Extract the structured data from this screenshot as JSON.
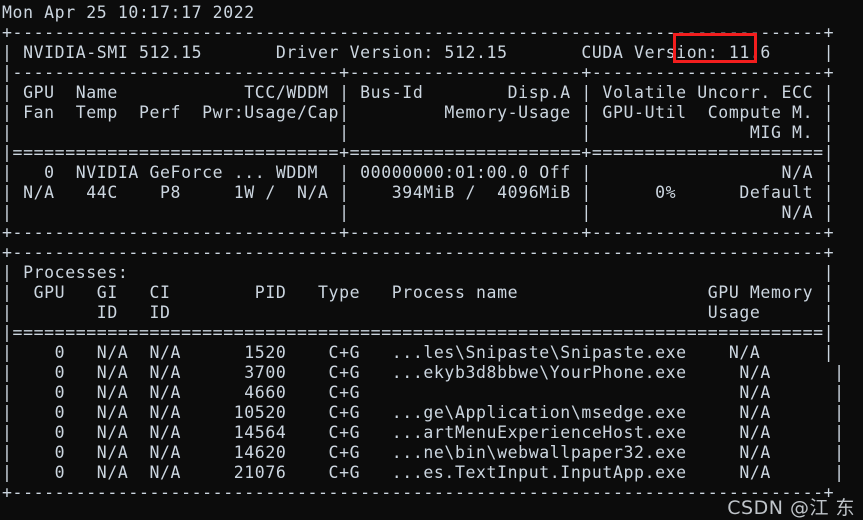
{
  "terminal": {
    "datestamp": "Mon Apr 25 10:17:17 2022",
    "background_color": "#0c0c0c",
    "text_color": "#ccd6e0",
    "highlight_color": "#f31e1e"
  },
  "smi_header": {
    "nvidia_smi_label": "NVIDIA-SMI",
    "nvidia_smi_version": "512.15",
    "driver_version_label": "Driver Version:",
    "driver_version": "512.15",
    "cuda_version_label": "CUDA Version:",
    "cuda_version": "11.6"
  },
  "gpu_table": {
    "header_row_1": [
      "GPU",
      "Name",
      "TCC/WDDM",
      "Bus-Id",
      "Disp.A",
      "Volatile Uncorr. ECC"
    ],
    "header_row_2": [
      "Fan",
      "Temp",
      "Perf",
      "Pwr:Usage/Cap",
      "Memory-Usage",
      "GPU-Util",
      "Compute M."
    ],
    "header_row_3": [
      "MIG M."
    ],
    "rows": [
      {
        "gpu": "0",
        "name": "NVIDIA GeForce ...",
        "tcc_wddm": "WDDM",
        "bus_id": "00000000:01:00.0",
        "disp_a": "Off",
        "ecc": "N/A",
        "fan": "N/A",
        "temp": "44C",
        "perf": "P8",
        "pwr_usage_cap": "1W /  N/A",
        "memory_usage": "394MiB /  4096MiB",
        "gpu_util": "0%",
        "compute_m": "Default",
        "mig_m": "N/A"
      }
    ]
  },
  "processes_section": {
    "title": "Processes:",
    "header_row_1": [
      "GPU",
      "GI",
      "CI",
      "PID",
      "Type",
      "Process name",
      "GPU Memory"
    ],
    "header_row_2": [
      "ID",
      "ID",
      "Usage"
    ],
    "rows": [
      {
        "gpu": "0",
        "gi_id": "N/A",
        "ci_id": "N/A",
        "pid": "1520",
        "type": "C+G",
        "process_name": "...les\\Snipaste\\Snipaste.exe",
        "gpu_memory_usage": "N/A"
      },
      {
        "gpu": "0",
        "gi_id": "N/A",
        "ci_id": "N/A",
        "pid": "3700",
        "type": "C+G",
        "process_name": "...ekyb3d8bbwe\\YourPhone.exe",
        "gpu_memory_usage": "N/A"
      },
      {
        "gpu": "0",
        "gi_id": "N/A",
        "ci_id": "N/A",
        "pid": "4660",
        "type": "C+G",
        "process_name": "",
        "gpu_memory_usage": "N/A"
      },
      {
        "gpu": "0",
        "gi_id": "N/A",
        "ci_id": "N/A",
        "pid": "10520",
        "type": "C+G",
        "process_name": "...ge\\Application\\msedge.exe",
        "gpu_memory_usage": "N/A"
      },
      {
        "gpu": "0",
        "gi_id": "N/A",
        "ci_id": "N/A",
        "pid": "14564",
        "type": "C+G",
        "process_name": "...artMenuExperienceHost.exe",
        "gpu_memory_usage": "N/A"
      },
      {
        "gpu": "0",
        "gi_id": "N/A",
        "ci_id": "N/A",
        "pid": "14620",
        "type": "C+G",
        "process_name": "...ne\\bin\\webwallpaper32.exe",
        "gpu_memory_usage": "N/A"
      },
      {
        "gpu": "0",
        "gi_id": "N/A",
        "ci_id": "N/A",
        "pid": "21076",
        "type": "C+G",
        "process_name": "...es.TextInput.InputApp.exe",
        "gpu_memory_usage": "N/A"
      }
    ]
  },
  "lines": {
    "l00_date": "Mon Apr 25 10:17:17 2022",
    "l01_top_border": "+-----------------------------------------------------------------------------+",
    "l02_smi": "| NVIDIA-SMI 512.15       Driver Version: 512.15       CUDA Version: 11.6     |",
    "l03_sep": "|-------------------------------+----------------------+----------------------+",
    "l04_hdr1": "| GPU  Name            TCC/WDDM | Bus-Id        Disp.A | Volatile Uncorr. ECC |",
    "l05_hdr2": "| Fan  Temp  Perf  Pwr:Usage/Cap|         Memory-Usage | GPU-Util  Compute M. |",
    "l06_hdr3": "|                               |                      |               MIG M. |",
    "l07_eq": "|===============================+======================+======================|",
    "l08_row1a": "|   0  NVIDIA GeForce ... WDDM  | 00000000:01:00.0 Off |                  N/A |",
    "l09_row1b": "| N/A   44C    P8     1W /  N/A |    394MiB /  4096MiB |      0%      Default |",
    "l10_row1c": "|                               |                      |                  N/A |",
    "l11_bottom": "+-------------------------------+----------------------+----------------------+",
    "l12_blank": "",
    "l13_ptop": "+-----------------------------------------------------------------------------+",
    "l14_ptitle": "| Processes:                                                                  |",
    "l15_phdr1": "|  GPU   GI   CI        PID   Type   Process name                  GPU Memory |",
    "l16_phdr2": "|        ID   ID                                                   Usage      |",
    "l17_peq": "|=============================================================================|",
    "l18_prow1": "|    0   N/A  N/A      1520    C+G   ...les\\Snipaste\\Snipaste.exe    N/A      |",
    "l19_prow2": "|    0   N/A  N/A      3700    C+G   ...ekyb3d8bbwe\\YourPhone.exe     N/A      |",
    "l20_prow3": "|    0   N/A  N/A      4660    C+G                                    N/A      |",
    "l21_prow4": "|    0   N/A  N/A     10520    C+G   ...ge\\Application\\msedge.exe     N/A      |",
    "l22_prow5": "|    0   N/A  N/A     14564    C+G   ...artMenuExperienceHost.exe     N/A      |",
    "l23_prow6": "|    0   N/A  N/A     14620    C+G   ...ne\\bin\\webwallpaper32.exe     N/A      |",
    "l24_prow7": "|    0   N/A  N/A     21076    C+G   ...es.TextInput.InputApp.exe     N/A      |",
    "l25_pbottom": "+-----------------------------------------------------------------------------+"
  },
  "watermark": {
    "text": "CSDN @江 东"
  }
}
